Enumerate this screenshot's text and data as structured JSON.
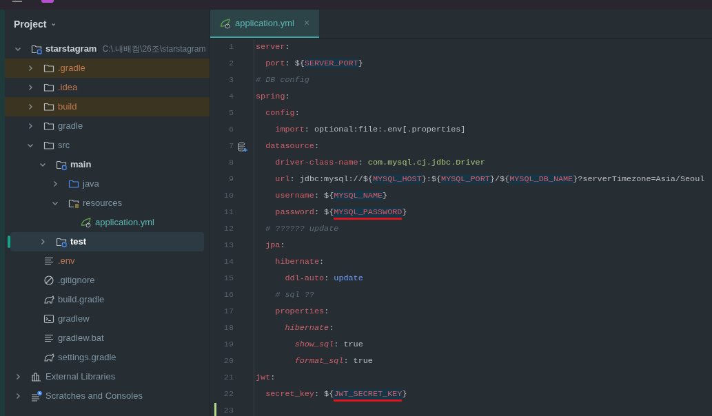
{
  "project_panel": {
    "title": "Project",
    "caret": "⌄"
  },
  "tree": [
    {
      "label": "starstagram",
      "path": "C:\\.내배캠\\26조\\starstagram",
      "kind": "module-folder",
      "ignored": false,
      "added": false,
      "expanded": true,
      "selected": false,
      "excluded": false,
      "children": [
        {
          "label": ".gradle",
          "kind": "folder",
          "ignored": true,
          "added": false,
          "expanded": false,
          "selected": false,
          "excluded": true
        },
        {
          "label": ".idea",
          "kind": "folder",
          "ignored": true,
          "added": false,
          "expanded": false,
          "selected": false,
          "excluded": false
        },
        {
          "label": "build",
          "kind": "folder",
          "ignored": true,
          "added": false,
          "expanded": false,
          "selected": false,
          "excluded": true
        },
        {
          "label": "gradle",
          "kind": "folder",
          "ignored": false,
          "added": false,
          "expanded": false,
          "selected": false,
          "excluded": false
        },
        {
          "label": "src",
          "kind": "folder",
          "ignored": false,
          "added": false,
          "expanded": true,
          "selected": false,
          "excluded": false,
          "children": [
            {
              "label": "main",
              "kind": "module-folder",
              "ignored": false,
              "added": false,
              "expanded": true,
              "selected": false,
              "excluded": false,
              "children": [
                {
                  "label": "java",
                  "kind": "source-folder",
                  "ignored": false,
                  "added": false,
                  "expanded": false,
                  "selected": false,
                  "excluded": false
                },
                {
                  "label": "resources",
                  "kind": "resources-folder",
                  "ignored": false,
                  "added": false,
                  "expanded": true,
                  "selected": false,
                  "excluded": false,
                  "children": [
                    {
                      "label": "application.yml",
                      "kind": "spring-file",
                      "ignored": false,
                      "added": true,
                      "selected": false,
                      "excluded": false
                    }
                  ]
                }
              ]
            },
            {
              "label": "test",
              "kind": "module-folder",
              "ignored": false,
              "added": false,
              "expanded": false,
              "selected": true,
              "excluded": false
            }
          ]
        },
        {
          "label": ".env",
          "kind": "text-file",
          "ignored": true,
          "added": false,
          "selected": false,
          "excluded": false
        },
        {
          "label": ".gitignore",
          "kind": "ignore-file",
          "ignored": false,
          "added": false,
          "selected": false,
          "excluded": false
        },
        {
          "label": "build.gradle",
          "kind": "gradle-file",
          "ignored": false,
          "added": false,
          "selected": false,
          "excluded": false
        },
        {
          "label": "gradlew",
          "kind": "terminal-file",
          "ignored": false,
          "added": false,
          "selected": false,
          "excluded": false
        },
        {
          "label": "gradlew.bat",
          "kind": "text-file",
          "ignored": false,
          "added": false,
          "selected": false,
          "excluded": false
        },
        {
          "label": "settings.gradle",
          "kind": "gradle-file",
          "ignored": false,
          "added": false,
          "selected": false,
          "excluded": false
        }
      ]
    },
    {
      "label": "External Libraries",
      "kind": "libraries",
      "ignored": false,
      "added": false,
      "expanded": false,
      "selected": false,
      "excluded": false
    },
    {
      "label": "Scratches and Consoles",
      "kind": "scratches",
      "ignored": false,
      "added": false,
      "expanded": false,
      "selected": false,
      "excluded": false
    }
  ],
  "tabs": [
    {
      "label": "application.yml",
      "close": "×",
      "selected": true
    }
  ],
  "code_lines": [
    {
      "number": "1",
      "tokens": [
        {
          "kind": "key",
          "text": "server"
        },
        {
          "kind": "punct",
          "text": ":"
        }
      ]
    },
    {
      "number": "2",
      "tokens": [
        {
          "kind": "key",
          "text": "  port"
        },
        {
          "kind": "punct",
          "text": ": ${"
        },
        {
          "kind": "var",
          "text": "SERVER_PORT",
          "underlined": false
        },
        {
          "kind": "punct",
          "text": "}"
        }
      ]
    },
    {
      "number": "3",
      "tokens": [
        {
          "kind": "comment",
          "text": "# DB config"
        }
      ]
    },
    {
      "number": "4",
      "tokens": [
        {
          "kind": "key",
          "text": "spring"
        },
        {
          "kind": "punct",
          "text": ":"
        }
      ]
    },
    {
      "number": "5",
      "tokens": [
        {
          "kind": "key",
          "text": "  config"
        },
        {
          "kind": "punct",
          "text": ":"
        }
      ]
    },
    {
      "number": "6",
      "tokens": [
        {
          "kind": "key",
          "text": "    import"
        },
        {
          "kind": "punct",
          "text": ": optional:file:.env[.properties]"
        }
      ]
    },
    {
      "number": "7",
      "gutter_mark": true,
      "tokens": [
        {
          "kind": "key",
          "text": "  datasource"
        },
        {
          "kind": "punct",
          "text": ":"
        }
      ]
    },
    {
      "number": "8",
      "tokens": [
        {
          "kind": "key",
          "text": "    driver-class-name"
        },
        {
          "kind": "punct",
          "text": ": "
        },
        {
          "kind": "string",
          "text": "com.mysql.cj.jdbc.Driver"
        }
      ]
    },
    {
      "number": "9",
      "tokens": [
        {
          "kind": "key",
          "text": "    url"
        },
        {
          "kind": "punct",
          "text": ": jdbc:mysql://${"
        },
        {
          "kind": "var",
          "text": "MYSQL_HOST",
          "underlined": false
        },
        {
          "kind": "punct",
          "text": "}:${"
        },
        {
          "kind": "var",
          "text": "MYSQL_PORT",
          "underlined": false
        },
        {
          "kind": "punct",
          "text": "}/${"
        },
        {
          "kind": "var",
          "text": "MYSQL_DB_NAME",
          "underlined": false
        },
        {
          "kind": "punct",
          "text": "}?serverTimezone=Asia/Seoul"
        }
      ]
    },
    {
      "number": "10",
      "tokens": [
        {
          "kind": "key",
          "text": "    username"
        },
        {
          "kind": "punct",
          "text": ": ${"
        },
        {
          "kind": "var",
          "text": "MYSQL_NAME",
          "underlined": false
        },
        {
          "kind": "punct",
          "text": "}"
        }
      ]
    },
    {
      "number": "11",
      "tokens": [
        {
          "kind": "key",
          "text": "    password"
        },
        {
          "kind": "punct",
          "text": ": ${"
        },
        {
          "kind": "var",
          "text": "MYSQL_PASSWORD",
          "underlined": true
        },
        {
          "kind": "punct",
          "text": "}"
        }
      ]
    },
    {
      "number": "12",
      "tokens": [
        {
          "kind": "comment",
          "text": "  # ?????? update"
        }
      ]
    },
    {
      "number": "13",
      "tokens": [
        {
          "kind": "key",
          "text": "  jpa"
        },
        {
          "kind": "punct",
          "text": ":"
        }
      ]
    },
    {
      "number": "14",
      "tokens": [
        {
          "kind": "key",
          "text": "    hibernate"
        },
        {
          "kind": "punct",
          "text": ":"
        }
      ]
    },
    {
      "number": "15",
      "tokens": [
        {
          "kind": "key",
          "text": "      ddl-auto"
        },
        {
          "kind": "punct",
          "text": ": "
        },
        {
          "kind": "keyword",
          "text": "update"
        }
      ]
    },
    {
      "number": "16",
      "tokens": [
        {
          "kind": "comment",
          "text": "    # sql ??"
        }
      ]
    },
    {
      "number": "17",
      "tokens": [
        {
          "kind": "key",
          "text": "    properties"
        },
        {
          "kind": "punct",
          "text": ":"
        }
      ]
    },
    {
      "number": "18",
      "tokens": [
        {
          "kind": "key-italic",
          "text": "      hibernate"
        },
        {
          "kind": "punct",
          "text": ":"
        }
      ]
    },
    {
      "number": "19",
      "tokens": [
        {
          "kind": "key-italic",
          "text": "        show_sql"
        },
        {
          "kind": "punct",
          "text": ": true"
        }
      ]
    },
    {
      "number": "20",
      "tokens": [
        {
          "kind": "key-italic",
          "text": "        format_sql"
        },
        {
          "kind": "punct",
          "text": ": true"
        }
      ]
    },
    {
      "number": "21",
      "tokens": [
        {
          "kind": "key",
          "text": "jwt"
        },
        {
          "kind": "punct",
          "text": ":"
        }
      ]
    },
    {
      "number": "22",
      "tokens": [
        {
          "kind": "key",
          "text": "  secret_key"
        },
        {
          "kind": "punct",
          "text": ": ${"
        },
        {
          "kind": "var",
          "text": "JWT_SECRET_KEY",
          "underlined": true
        },
        {
          "kind": "punct",
          "text": "}"
        }
      ]
    },
    {
      "number": "23",
      "changed": true
    }
  ]
}
